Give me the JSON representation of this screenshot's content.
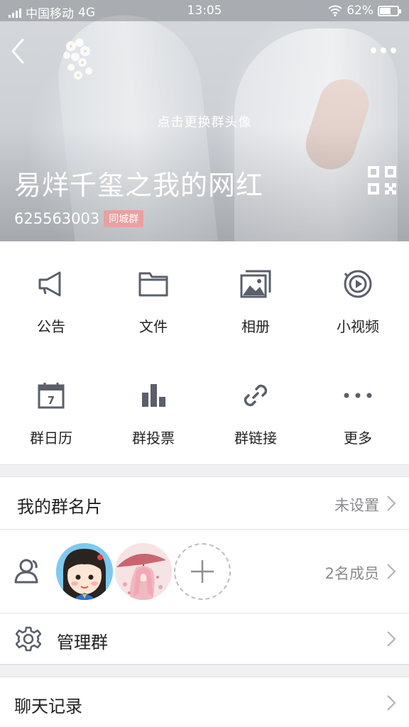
{
  "status_bar": {
    "carrier": "中国移动",
    "network": "4G",
    "time": "13:05",
    "battery_text": "62%",
    "battery_level": 0.62
  },
  "header": {
    "avatar_hint": "点击更换群头像",
    "group_name": "易烊千玺之我的网红",
    "group_id": "625563003",
    "group_tag": "同城群",
    "back_icon": "chevron-left-icon",
    "more_icon": "more-dots-icon",
    "qr_icon": "qr-code-icon"
  },
  "grid": {
    "items": [
      {
        "label": "公告",
        "icon": "megaphone-icon"
      },
      {
        "label": "文件",
        "icon": "folder-icon"
      },
      {
        "label": "相册",
        "icon": "photo-album-icon"
      },
      {
        "label": "小视频",
        "icon": "video-play-icon"
      },
      {
        "label": "群日历",
        "icon": "calendar-icon",
        "calendar_day": "7"
      },
      {
        "label": "群投票",
        "icon": "bar-chart-icon"
      },
      {
        "label": "群链接",
        "icon": "link-icon"
      },
      {
        "label": "更多",
        "icon": "more-dots-icon"
      }
    ]
  },
  "card": {
    "title": "我的群名片",
    "value": "未设置"
  },
  "members": {
    "count_text": "2名成员",
    "icon": "members-icon"
  },
  "manage": {
    "title": "管理群",
    "icon": "gear-icon"
  },
  "chat_history": {
    "title": "聊天记录"
  },
  "colors": {
    "icon_gray": "#5a5f6b",
    "tag_pink": "#e9a0a0",
    "divider": "#f0f0f2",
    "secondary_text": "#8a8a8f"
  }
}
